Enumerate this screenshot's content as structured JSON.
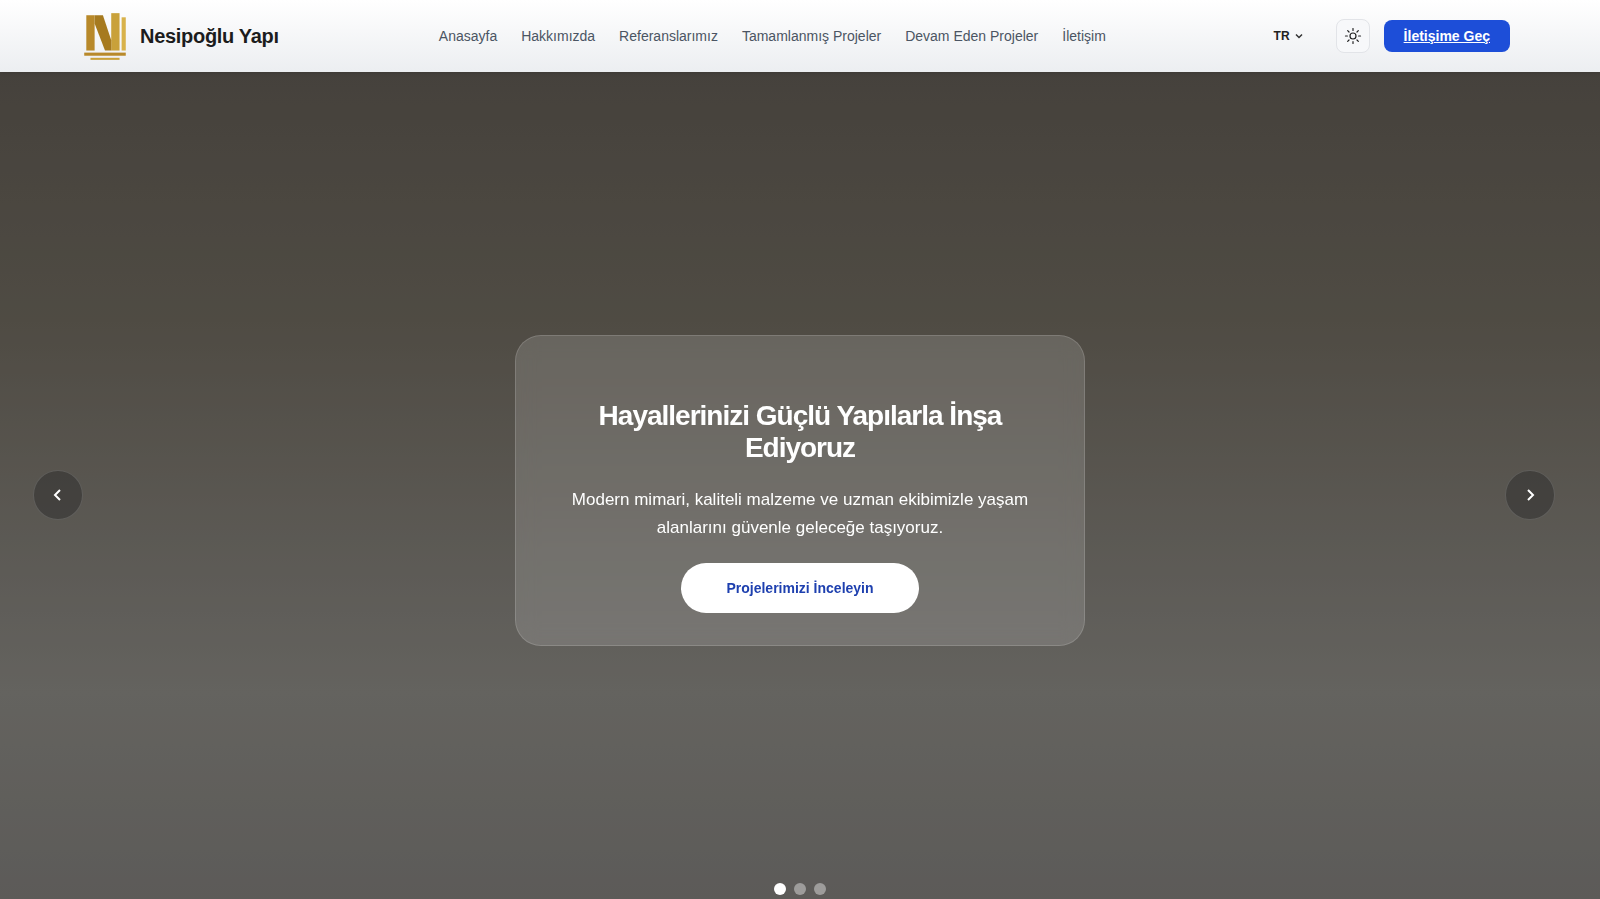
{
  "header": {
    "brand": "Nesipoğlu Yapı",
    "nav": [
      {
        "label": "Anasayfa",
        "selected": false
      },
      {
        "label": "Hakkımızda",
        "selected": false
      },
      {
        "label": "Referanslarımız",
        "selected": false
      },
      {
        "label": "Tamamlanmış Projeler",
        "selected": false
      },
      {
        "label": "Devam Eden Projeler",
        "selected": false
      },
      {
        "label": "İletişim",
        "selected": false
      }
    ],
    "language": "TR",
    "cta": "İletişime Geç"
  },
  "hero": {
    "title": "Hayallerinizi Güçlü Yapılarla İnşa Ediyoruz",
    "subtitle": "Modern mimari, kaliteli malzeme ve uzman ekibimizle yaşam alanlarını güvenle geleceğe taşıyoruz.",
    "button": "Projelerimizi İnceleyin",
    "slides": [
      {
        "selected": true
      },
      {
        "selected": false
      },
      {
        "selected": false
      }
    ]
  }
}
